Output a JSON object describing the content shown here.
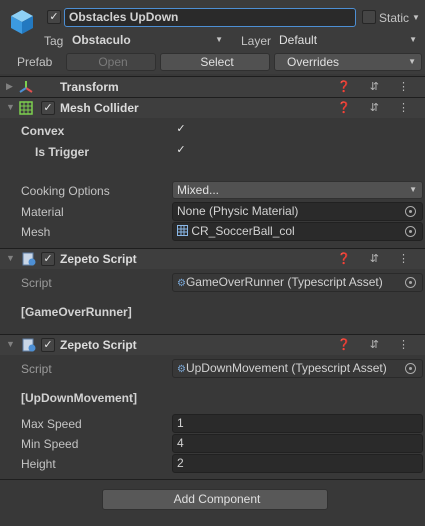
{
  "header": {
    "object_name": "Obstacles UpDown",
    "static_label": "Static",
    "tag_label": "Tag",
    "tag_value": "Obstaculo",
    "layer_label": "Layer",
    "layer_value": "Default",
    "prefab_label": "Prefab",
    "open_label": "Open",
    "select_label": "Select",
    "overrides_label": "Overrides"
  },
  "transform": {
    "title": "Transform"
  },
  "mesh_collider": {
    "title": "Mesh Collider",
    "convex_label": "Convex",
    "is_trigger_label": "Is Trigger",
    "cooking_label": "Cooking Options",
    "cooking_value": "Mixed...",
    "material_label": "Material",
    "material_value": "None (Physic Material)",
    "mesh_label": "Mesh",
    "mesh_value": "CR_SoccerBall_col"
  },
  "script1": {
    "title": "Zepeto Script",
    "script_label": "Script",
    "script_value": "GameOverRunner (Typescript Asset)",
    "class_label": "[GameOverRunner]"
  },
  "script2": {
    "title": "Zepeto Script",
    "script_label": "Script",
    "script_value": "UpDownMovement (Typescript Asset)",
    "class_label": "[UpDownMovement]",
    "props": [
      {
        "label": "Max Speed",
        "value": "1"
      },
      {
        "label": "Min Speed",
        "value": "4"
      },
      {
        "label": "Height",
        "value": "2"
      }
    ]
  },
  "add_component_label": "Add Component",
  "icons": {
    "header_icons": "❓ ⇵ ⋮",
    "check": "✓",
    "arrow": "▼",
    "fold": "▶",
    "fold_open": "▼"
  },
  "colors": {
    "accent": "#4d8fd4",
    "background": "#383838"
  }
}
